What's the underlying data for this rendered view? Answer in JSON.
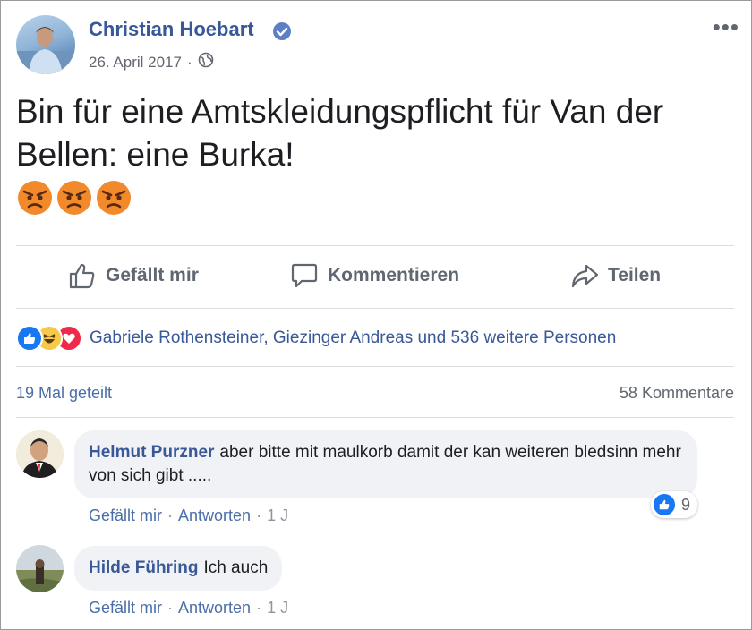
{
  "post": {
    "author": "Christian Hoebart",
    "date": "26. April 2017",
    "separator": "·",
    "text": "Bin für eine Amtskleidungspflicht für Van der Bellen: eine Burka!",
    "emoji_icons": [
      "angry-face-icon",
      "angry-face-icon",
      "angry-face-icon"
    ]
  },
  "actions": {
    "like": "Gefällt mir",
    "comment": "Kommentieren",
    "share": "Teilen"
  },
  "reactions": {
    "icons": [
      "like-icon",
      "haha-icon",
      "love-icon"
    ],
    "text": "Gabriele Rothensteiner, Giezinger Andreas und 536 weitere Personen"
  },
  "stats": {
    "shares": "19 Mal geteilt",
    "comments": "58 Kommentare"
  },
  "comments": [
    {
      "name": "Helmut Purzner",
      "text": "aber bitte mit maulkorb damit der kan weiteren bledsinn mehr von sich gibt .....",
      "like": "Gefällt mir",
      "reply": "Antworten",
      "time": "1 J",
      "reaction_count": "9"
    },
    {
      "name": "Hilde Führing",
      "text": "Ich auch",
      "like": "Gefällt mir",
      "reply": "Antworten",
      "time": "1 J"
    }
  ],
  "colors": {
    "link_blue": "#385898",
    "fb_blue": "#1877f2",
    "angry_orange": "#f28a2b"
  }
}
